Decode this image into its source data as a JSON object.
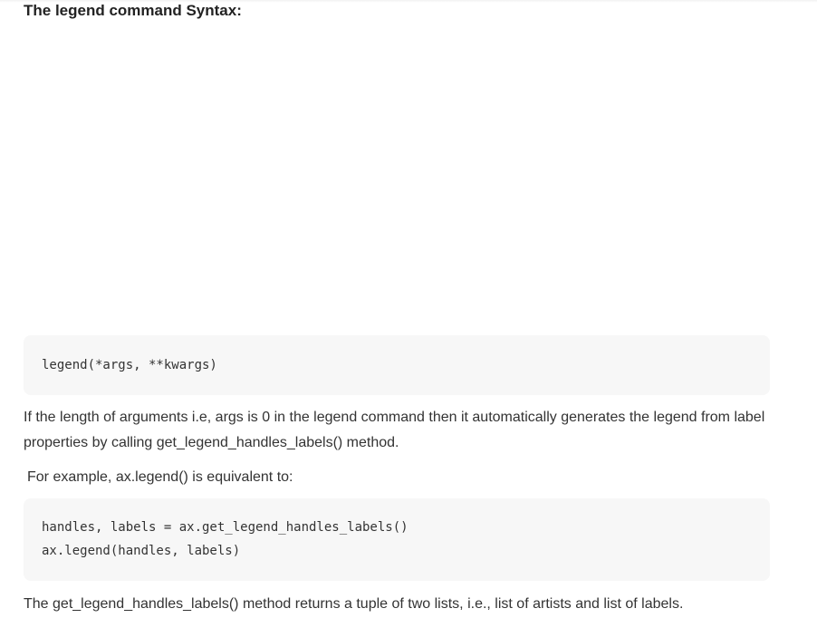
{
  "heading": "The legend command Syntax:",
  "code_block_1": {
    "lines": [
      "legend(*args, **kwargs)"
    ]
  },
  "paragraph_1": "If the length of arguments i.e, args is 0 in the legend command then it automatically generates the legend from label properties by calling get_legend_handles_labels() method.",
  "paragraph_2": "For example, ax.legend() is equivalent to:",
  "code_block_2": {
    "lines": [
      "handles, labels = ax.get_legend_handles_labels()",
      "ax.legend(handles, labels)"
    ]
  },
  "paragraph_3": "The get_legend_handles_labels() method returns a tuple of two lists, i.e., list of artists and list of labels.",
  "colors": {
    "code_background": "#f7f7f7",
    "text": "#333333",
    "heading": "#222222"
  }
}
